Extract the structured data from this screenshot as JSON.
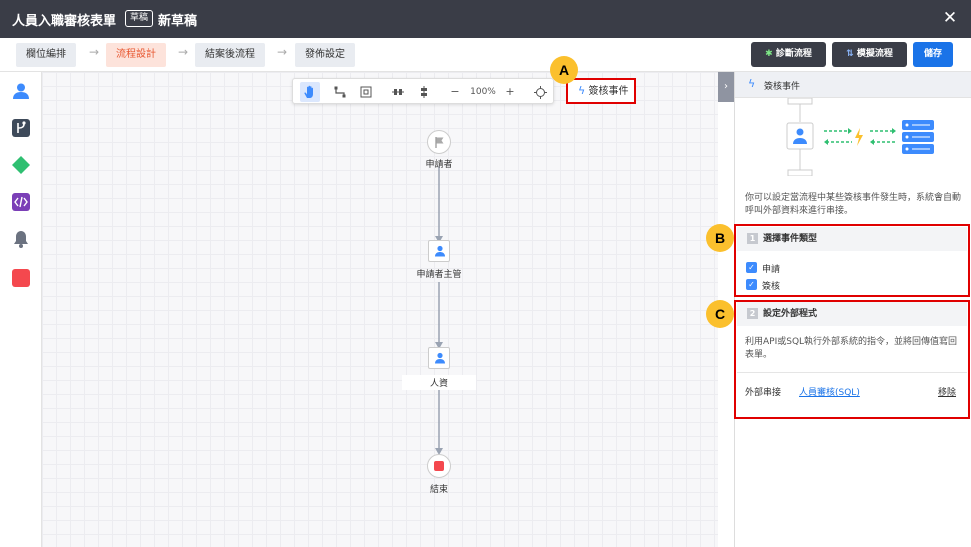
{
  "window": {
    "title": "人員入職審核表單",
    "draft_badge": "草稿",
    "draft_name": "新草稿",
    "close_label": "✕"
  },
  "steps": [
    {
      "label": "欄位編排"
    },
    {
      "label": "流程設計"
    },
    {
      "label": "結案後流程"
    },
    {
      "label": "發佈設定"
    }
  ],
  "actions": {
    "diagnose": "診斷流程",
    "simulate": "模擬流程",
    "save": "儲存"
  },
  "toolbar": {
    "zoom_out": "−",
    "zoom": "100%",
    "zoom_in": "+"
  },
  "sign_event_button": "簽核事件",
  "markers": {
    "a": "A",
    "b": "B",
    "c": "C"
  },
  "flow_nodes": [
    {
      "label": "申請者"
    },
    {
      "label": "申請者主管"
    },
    {
      "label": "人資"
    },
    {
      "label": "結束"
    }
  ],
  "panel": {
    "header": "簽核事件",
    "description": "你可以設定當流程中某些簽核事件發生時，系統會自動呼叫外部資料來進行串接。",
    "section1": {
      "number": "1",
      "title": "選擇事件類型",
      "options": [
        {
          "label": "申請",
          "checked": true
        },
        {
          "label": "簽核",
          "checked": true
        }
      ]
    },
    "section2": {
      "number": "2",
      "title": "設定外部程式",
      "description": "利用API或SQL執行外部系統的指令，並將回傳值寫回表單。",
      "link_label": "外部串接",
      "link_value": "人員審核(SQL)",
      "remove": "移除"
    }
  },
  "colors": {
    "titlebar": "#3a3d47",
    "accent_orange": "#e8562f",
    "primary_blue": "#1a73e8",
    "dark_button": "#3a3d47",
    "highlight_red": "#e00000",
    "marker_yellow": "#fbc02d",
    "end_red": "#f4484e"
  }
}
